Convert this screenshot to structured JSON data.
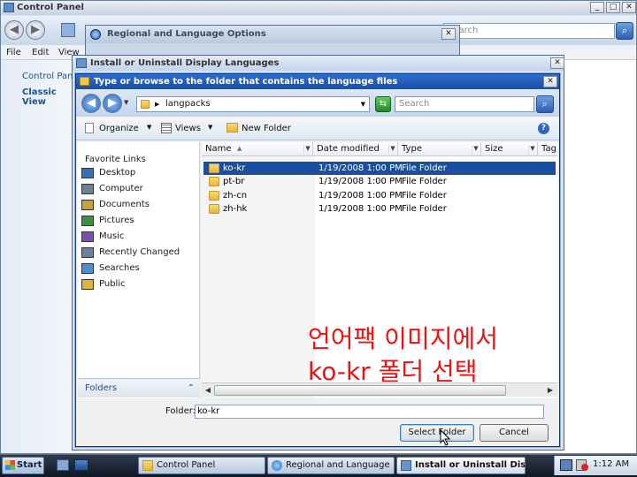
{
  "control_panel": {
    "title": "Control Panel",
    "search_placeholder": "Search",
    "menu": [
      "File",
      "Edit",
      "View"
    ],
    "sidebar_home": "Control Panel",
    "sidebar_classic": "Classic View"
  },
  "regional": {
    "title": "Regional and Language Options"
  },
  "install": {
    "title": "Install or Uninstall Display Languages"
  },
  "browse": {
    "title": "Type or browse to the folder that contains the language files",
    "path": "langpacks",
    "search_placeholder": "Search",
    "toolbar": {
      "organize": "Organize",
      "views": "Views",
      "new_folder": "New Folder"
    },
    "favorite_links_header": "Favorite Links",
    "favorites": [
      {
        "label": "Desktop",
        "icon": "desktop-icon"
      },
      {
        "label": "Computer",
        "icon": "computer-icon"
      },
      {
        "label": "Documents",
        "icon": "documents-icon"
      },
      {
        "label": "Pictures",
        "icon": "pictures-icon"
      },
      {
        "label": "Music",
        "icon": "music-icon"
      },
      {
        "label": "Recently Changed",
        "icon": "recent-icon"
      },
      {
        "label": "Searches",
        "icon": "search-folder-icon"
      },
      {
        "label": "Public",
        "icon": "folder-icon"
      }
    ],
    "folders_label": "Folders",
    "columns": [
      "Name",
      "Date modified",
      "Type",
      "Size",
      "Tag"
    ],
    "files": [
      {
        "name": "ko-kr",
        "date": "1/19/2008 1:00 PM",
        "type": "File Folder",
        "selected": true
      },
      {
        "name": "pt-br",
        "date": "1/19/2008 1:00 PM",
        "type": "File Folder",
        "selected": false
      },
      {
        "name": "zh-cn",
        "date": "1/19/2008 1:00 PM",
        "type": "File Folder",
        "selected": false
      },
      {
        "name": "zh-hk",
        "date": "1/19/2008 1:00 PM",
        "type": "File Folder",
        "selected": false
      }
    ],
    "folder_label": "Folder:",
    "folder_value": "ko-kr",
    "select_button": "Select Folder",
    "cancel_button": "Cancel"
  },
  "annotation": {
    "line1": "언어팩 이미지에서",
    "line2": "ko-kr 폴더 선택",
    "color": "#ee1111"
  },
  "taskbar": {
    "start": "Start",
    "tasks": [
      "Control Panel",
      "Regional and Language ...",
      "Install or Uninstall Dis..."
    ],
    "clock": "1:12 AM"
  }
}
